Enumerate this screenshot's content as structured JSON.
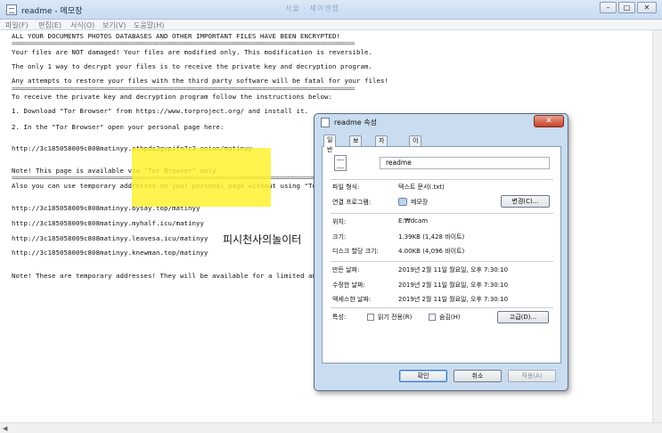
{
  "notepad": {
    "title": "readme - 메모장",
    "title_blur": "서울 ·  제이엔엠",
    "menu": [
      "파일(F)",
      "편집(E)",
      "서식(O)",
      "보기(V)",
      "도움말(H)"
    ],
    "lines": [
      "ALL YOUR DOCUMENTS PHOTOS DATABASES AND OTHER IMPORTANT FILES HAVE BEEN ENCRYPTED!",
      "====================================================================================================",
      "Your files are NOT damaged! Your files are modified only. This modification is reversible.",
      "The only 1 way to decrypt your files is to receive the private key and decryption program.",
      "Any attempts to restore your files with the third party software will be fatal for your files!",
      "====================================================================================================",
      "To receive the private key and decryption program follow the instructions below:",
      "1. Download \"Tor Browser\" from https://www.torproject.org/ and install it.",
      "2. In the \"Tor Browser\" open your personal page here:",
      "http://3c185058009c808matinyy.othpda3gvpifn7c3.onion/matinyy",
      "Note! This page is available via \"Tor Browser\" only.",
      "====================================================================================================",
      "Also you can use temporary addresses on your personal page without using \"To",
      "http://3c185058009c808matinyy.bysay.top/matinyy",
      "http://3c185058009c808matinyy.myhalf.icu/matinyy",
      "http://3c185058009c808matinyy.leavesa.icu/matinyy",
      "http://3c185058009c808matinyy.knewman.top/matinyy",
      "Note! These are temporary addresses! They will be available for a limited am"
    ],
    "watermark": "피시천사의놀이터",
    "highlight_color": "#fff028"
  },
  "dialog": {
    "title": "readme 속성",
    "close": "✕",
    "tabs": [
      "일반",
      "보안",
      "자세히",
      "이전 버전"
    ],
    "filename": "readme",
    "rows": {
      "type_label": "파일 형식:",
      "type_value": "텍스트 문서(.txt)",
      "open_label": "연결 프로그램:",
      "open_value": "메모장",
      "change_btn": "변경(C)...",
      "loc_label": "위치:",
      "loc_value": "E:₩dcam",
      "size_label": "크기:",
      "size_value": "1.39KB (1,428 바이트)",
      "disk_label": "디스크 할당 크기:",
      "disk_value": "4.00KB (4,096 바이트)",
      "created_label": "만든 날짜:",
      "created_value": "2019년 2월 11일 월요일, 오후 7:30:10",
      "modified_label": "수정한 날짜:",
      "modified_value": "2019년 2월 11일 월요일, 오후 7:30:10",
      "accessed_label": "액세스한 날짜:",
      "accessed_value": "2019년 2월 11일 월요일, 오후 7:30:10",
      "attr_label": "특성:",
      "readonly": "읽기 전용(R)",
      "hidden": "숨김(H)",
      "advanced_btn": "고급(D)..."
    },
    "ok": "확인",
    "cancel": "취소",
    "apply": "적용(A)"
  }
}
